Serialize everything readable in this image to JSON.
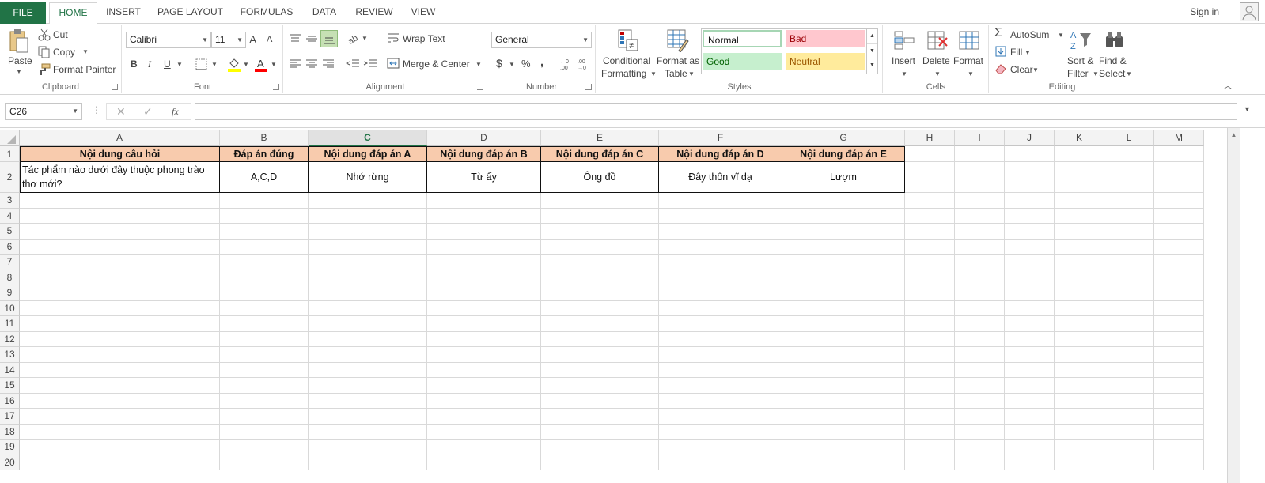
{
  "tabs": {
    "file": "FILE",
    "home": "HOME",
    "insert": "INSERT",
    "page_layout": "PAGE LAYOUT",
    "formulas": "FORMULAS",
    "data": "DATA",
    "review": "REVIEW",
    "view": "VIEW",
    "signin": "Sign in"
  },
  "clipboard": {
    "paste": "Paste",
    "cut": "Cut",
    "copy": "Copy",
    "format_painter": "Format Painter",
    "label": "Clipboard"
  },
  "font": {
    "name": "Calibri",
    "size": "11",
    "bold": "B",
    "italic": "I",
    "underline": "U",
    "grow": "A",
    "shrink": "A",
    "label": "Font"
  },
  "alignment": {
    "wrap_text": "Wrap Text",
    "merge_center": "Merge & Center",
    "label": "Alignment"
  },
  "number": {
    "format": "General",
    "currency": "$",
    "percent": "%",
    "comma": ",",
    "label": "Number"
  },
  "styles": {
    "conditional1": "Conditional",
    "conditional2": "Formatting",
    "format_as1": "Format as",
    "format_as2": "Table",
    "normal": "Normal",
    "bad": "Bad",
    "good": "Good",
    "neutral": "Neutral",
    "label": "Styles",
    "colors": {
      "normal_bg": "#ffffff",
      "bad_bg": "#ffc7ce",
      "bad_fg": "#9c0006",
      "good_bg": "#c6efce",
      "good_fg": "#006100",
      "neutral_bg": "#ffeb9c",
      "neutral_fg": "#9c5700"
    }
  },
  "cells_group": {
    "insert": "Insert",
    "delete": "Delete",
    "format": "Format",
    "label": "Cells"
  },
  "editing": {
    "autosum": "AutoSum",
    "fill": "Fill",
    "clear": "Clear",
    "sort1": "Sort &",
    "sort2": "Filter",
    "find1": "Find &",
    "find2": "Select",
    "label": "Editing"
  },
  "formula_bar": {
    "name_box": "C26",
    "fx": "fx",
    "value": ""
  },
  "sheet": {
    "columns": [
      "A",
      "B",
      "C",
      "D",
      "E",
      "F",
      "G",
      "H",
      "I",
      "J",
      "K",
      "L",
      "M"
    ],
    "selected_column": "C",
    "rows": [
      "1",
      "2",
      "3",
      "4",
      "5",
      "6",
      "7",
      "8",
      "9",
      "10",
      "11",
      "12",
      "13",
      "14",
      "15",
      "16",
      "17",
      "18",
      "19",
      "20"
    ],
    "header_row": [
      "Nội dung câu hỏi",
      "Đáp án đúng",
      "Nội dung đáp án A",
      "Nội dung đáp án B",
      "Nội dung đáp án C",
      "Nội dung đáp án D",
      "Nội dung đáp án E"
    ],
    "data_row": [
      "Tác phẩm nào dưới đây thuộc phong trào thơ mới?",
      "A,C,D",
      "Nhớ rừng",
      "Từ ấy",
      "Ông đồ",
      "Đây thôn vĩ dạ",
      "Lượm"
    ],
    "header_fill": "#f8cbad"
  },
  "accent": "#217346"
}
